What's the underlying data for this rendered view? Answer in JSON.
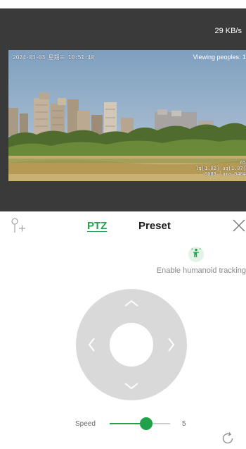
{
  "player": {
    "data_rate": "29 KB/s",
    "osd_datetime": "2024-03-03 星期三 10:51:40",
    "viewers": "Viewing peoples: 1",
    "osd_line1": "65",
    "osd_line2": "lg[1.02] ag[1.07]",
    "osd_line3": "0083 luma 0404"
  },
  "toolbar": {
    "add_icon": "location-pin-plus-icon",
    "tabs": [
      {
        "label": "PTZ",
        "active": true
      },
      {
        "label": "Preset",
        "active": false
      }
    ],
    "close_icon": "close-icon"
  },
  "tracking": {
    "icon": "humanoid-tracking-icon",
    "label": "Enable humanoid tracking"
  },
  "ptz": {
    "directions": [
      "up",
      "down",
      "left",
      "right"
    ]
  },
  "speed": {
    "label": "Speed",
    "value": "5",
    "level_fraction": 0.6
  },
  "colors": {
    "accent": "#21a24a",
    "pad": "#d9d9d9",
    "player_bg": "#3a3a3a"
  }
}
